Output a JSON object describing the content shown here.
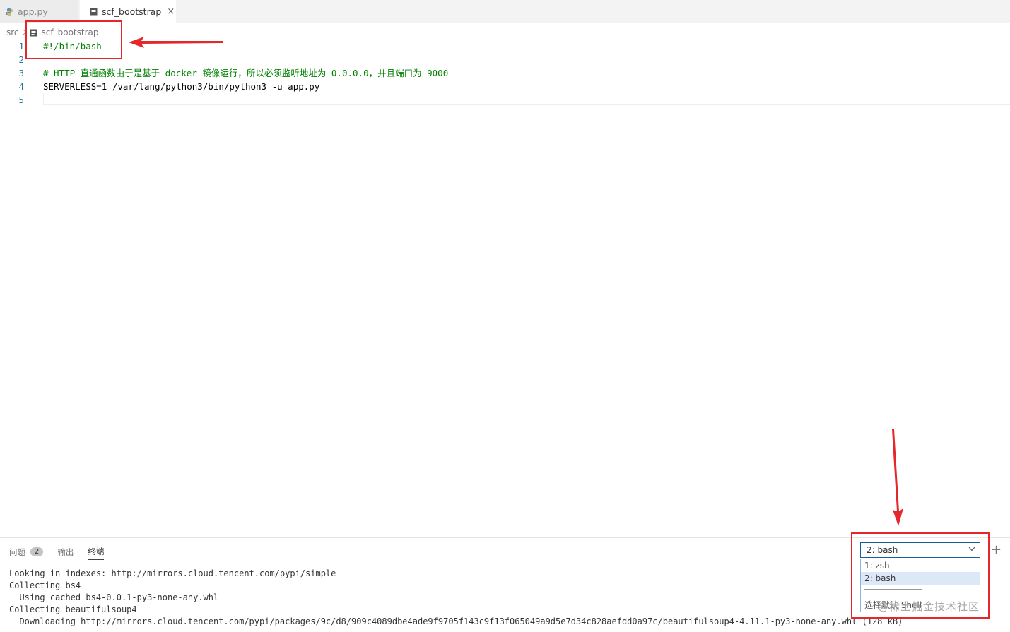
{
  "tabs": [
    {
      "label": "app.py",
      "icon": "python-icon",
      "active": false
    },
    {
      "label": "scf_bootstrap",
      "icon": "file-icon",
      "active": true,
      "close": "×"
    }
  ],
  "breadcrumb": {
    "folder": "src",
    "file": "scf_bootstrap"
  },
  "editor": {
    "line_numbers": [
      "1",
      "2",
      "3",
      "4",
      "5"
    ],
    "lines": [
      {
        "text": "#!/bin/bash",
        "kind": "comment"
      },
      {
        "text": "",
        "kind": "plain"
      },
      {
        "text": "# HTTP 直通函数由于是基于 docker 镜像运行，所以必须监听地址为 0.0.0.0，并且端口为 9000",
        "kind": "comment"
      },
      {
        "text": "SERVERLESS=1 /var/lang/python3/bin/python3 -u app.py",
        "kind": "plain"
      },
      {
        "text": "",
        "kind": "plain"
      }
    ]
  },
  "panel": {
    "tabs": [
      {
        "label": "问题",
        "badge": "2"
      },
      {
        "label": "输出"
      },
      {
        "label": "终端",
        "active": true
      }
    ],
    "terminal_lines": [
      {
        "text": "Looking in indexes: http://mirrors.cloud.tencent.com/pypi/simple"
      },
      {
        "text": "Collecting bs4"
      },
      {
        "text": "  Using cached bs4-0.0.1-py3-none-any.whl"
      },
      {
        "text": "Collecting beautifulsoup4"
      },
      {
        "text": "  Downloading http://mirrors.cloud.tencent.com/pypi/packages/9c/d8/909c4089dbe4ade9f9705f143c9f13f065049a9d5e7d34c828aefdd0a97c/beautifulsoup4-4.11.1-py3-none-any.whl (128 kB)"
      }
    ],
    "plus": "+"
  },
  "terminal_select": {
    "value": "2: bash",
    "options": [
      "1: zsh",
      "2: bash"
    ],
    "last_option": "选择默认 Shell"
  },
  "watermark": "@稀土掘金技术社区",
  "colors": {
    "annotation_red": "#e5262b",
    "comment_green": "#008000",
    "line_number": "#237893"
  }
}
